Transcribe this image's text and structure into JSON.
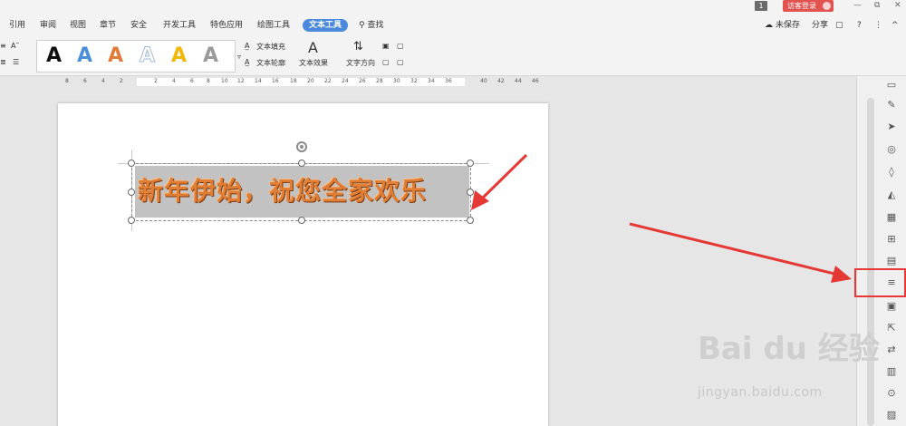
{
  "titlebar": {
    "count": "1",
    "login_label": "访客登录",
    "min": "—",
    "restore": "⧉",
    "close": "✕"
  },
  "menu": {
    "tabs": [
      {
        "label": "引用"
      },
      {
        "label": "审阅"
      },
      {
        "label": "视图"
      },
      {
        "label": "章节"
      },
      {
        "label": "安全"
      },
      {
        "label": "开发工具"
      },
      {
        "label": "特色应用"
      },
      {
        "label": "绘图工具"
      },
      {
        "label": "文本工具"
      },
      {
        "label": "查找"
      }
    ],
    "active_tab": "文本工具",
    "right": {
      "unsaved": "未保存",
      "share": "分享",
      "help": "?",
      "more": "⋮",
      "collapse": "^"
    }
  },
  "ribbon": {
    "styles": [
      "A",
      "A",
      "A",
      "A",
      "A",
      "A"
    ],
    "style_colors": [
      "#111111",
      "#4a90d9",
      "#e07b39",
      "#9fb8d6",
      "#f2b807",
      "#9a9a9a"
    ],
    "text_fill": "文本填充",
    "text_outline": "文本轮廓",
    "text_effect": "文本效果",
    "text_direction": "文字方向"
  },
  "ruler": {
    "ticks": [
      "8",
      "6",
      "4",
      "2",
      "2",
      "4",
      "6",
      "8",
      "10",
      "12",
      "14",
      "16",
      "18",
      "20",
      "22",
      "24",
      "26",
      "28",
      "30",
      "32",
      "34",
      "36",
      "40",
      "42",
      "44",
      "46"
    ]
  },
  "document": {
    "wordart_text": "新年伊始，祝您全家欢乐"
  },
  "watermark": {
    "main": "Bai du 经验",
    "sub": "jingyan.baidu.com"
  },
  "colors": {
    "accent": "#4a89dc",
    "annotation": "#e53935",
    "login": "#e2524f"
  }
}
